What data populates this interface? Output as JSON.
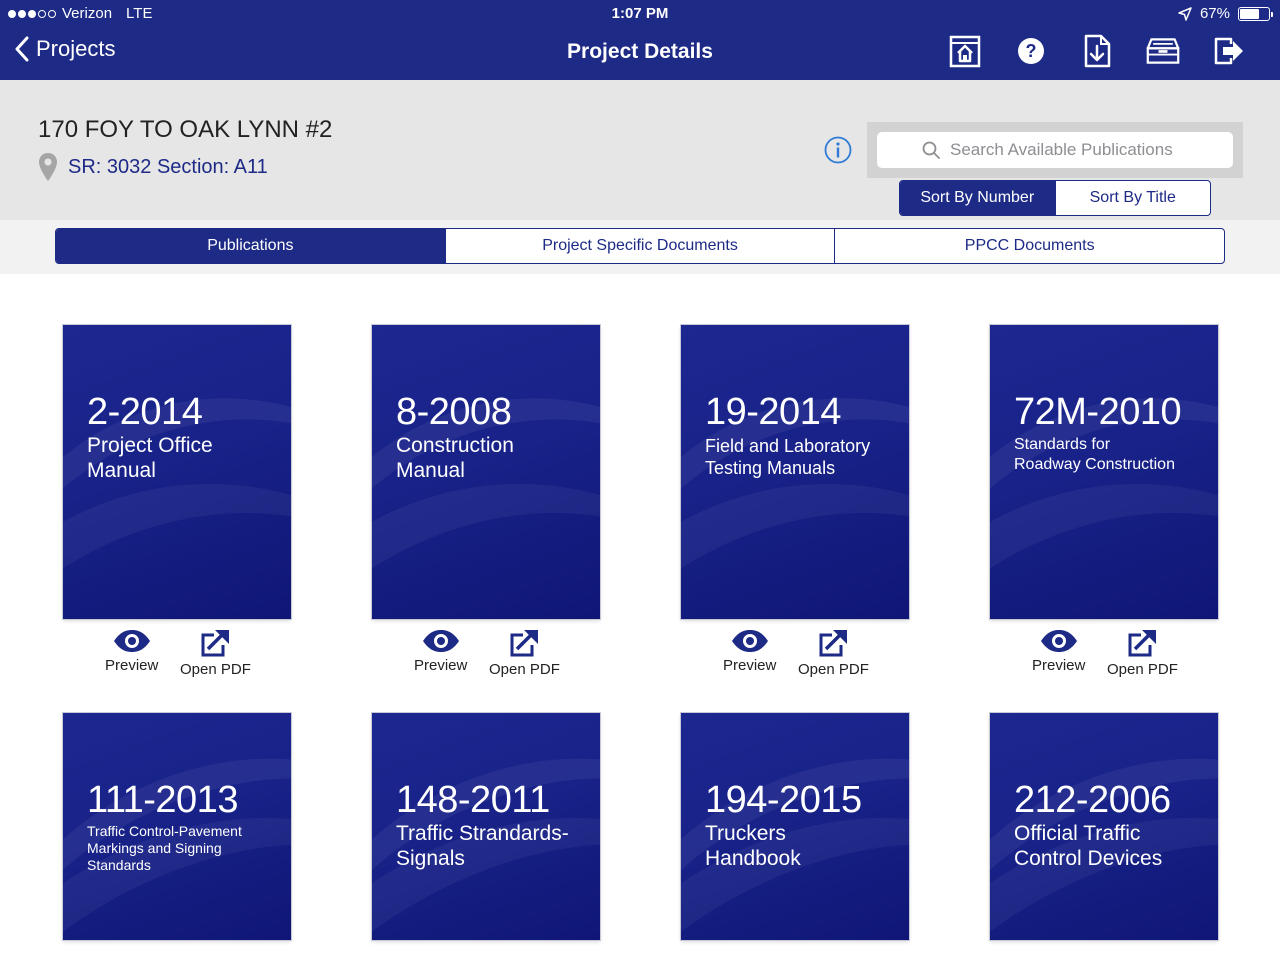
{
  "status_bar": {
    "carrier": "Verizon",
    "network": "LTE",
    "time": "1:07 PM",
    "battery": "67%",
    "battery_level": 0.67
  },
  "nav": {
    "back_label": "Projects",
    "title": "Project Details",
    "icons": [
      "home-document-icon",
      "help-icon",
      "download-icon",
      "archive-icon",
      "logout-icon"
    ]
  },
  "project": {
    "name": "170 FOY TO OAK LYNN #2",
    "location": "SR: 3032 Section: A11"
  },
  "search": {
    "placeholder": "Search Available Publications"
  },
  "sort": {
    "by_number": "Sort By Number",
    "by_title": "Sort By Title",
    "active": "by_number"
  },
  "tabs": {
    "publications": "Publications",
    "project_specific": "Project Specific Documents",
    "ppcc": "PPCC Documents",
    "active": "publications"
  },
  "actions": {
    "preview": "Preview",
    "open_pdf": "Open PDF"
  },
  "colors": {
    "brand": "#1d2a86",
    "header_bg": "#e6e6e6"
  },
  "publications": [
    {
      "number": "2-2014",
      "title_lines": [
        "Project Office",
        "Manual"
      ]
    },
    {
      "number": "8-2008",
      "title_lines": [
        "Construction",
        "Manual"
      ]
    },
    {
      "number": "19-2014",
      "title_lines": [
        "Field and Laboratory",
        "Testing Manuals"
      ]
    },
    {
      "number": "72M-2010",
      "title_lines": [
        "Standards for",
        "Roadway Construction"
      ]
    },
    {
      "number": "111-2013",
      "title_lines": [
        "Traffic Control-Pavement",
        "Markings and Signing",
        "Standards"
      ]
    },
    {
      "number": "148-2011",
      "title_lines": [
        "Traffic Strandards-",
        "Signals"
      ]
    },
    {
      "number": "194-2015",
      "title_lines": [
        "Truckers",
        "Handbook"
      ]
    },
    {
      "number": "212-2006",
      "title_lines": [
        "Official Traffic",
        "Control Devices"
      ]
    }
  ]
}
